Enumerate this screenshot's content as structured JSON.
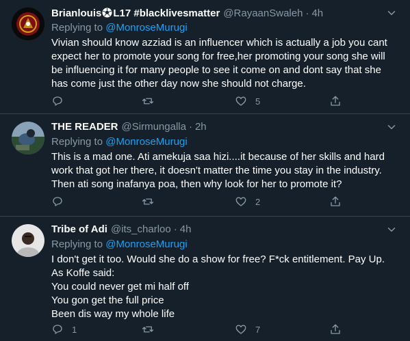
{
  "tweets": [
    {
      "name": "Brianlouis",
      "name_suffix": "L17 #blacklivesmatter",
      "handle": "@RayaanSwaleh",
      "time": "4h",
      "replying_label": "Replying to",
      "replying_to": "@MonroseMurugi",
      "lines": [
        "Vivian should know azziad is an influencer which is actually a job you cant",
        "expect her to promote your song for free,her promoting your song she will",
        "be influencing it for many people to see it come on and dont say that she",
        "has come just the other day now she should not charge."
      ],
      "replies": "",
      "retweets": "",
      "likes": "5",
      "avatar_colors": [
        "#0a0a0a",
        "#7a0f14",
        "#d4a017"
      ]
    },
    {
      "name": "THE READER",
      "handle": "@Sirmungalla",
      "time": "2h",
      "replying_label": "Replying to",
      "replying_to": "@MonroseMurugi",
      "lines": [
        "This is a mad one. Ati amekuja saa hizi....it because of her skills and hard",
        "work that got her there, it doesn't matter the time you stay in the industry.",
        "Then ati song inafanya poa, then why look for her to promote it?"
      ],
      "replies": "",
      "retweets": "",
      "likes": "2",
      "avatar_colors": [
        "#3c5a7a",
        "#8aa2b8",
        "#2d4a33"
      ]
    },
    {
      "name": "Tribe of Adi",
      "handle": "@its_charloo",
      "time": "4h",
      "replying_label": "Replying to",
      "replying_to": "@MonroseMurugi",
      "lines": [
        "I don't get it too. Would she do a show for free? F*ck entitlement. Pay Up.",
        "As Koffe said:",
        "You could never get mi half off",
        "You gon get the full price",
        "Been dis way my whole life"
      ],
      "replies": "1",
      "retweets": "",
      "likes": "7",
      "avatar_colors": [
        "#e6e6e6",
        "#3a2a22",
        "#b9b9b9"
      ]
    }
  ],
  "icons": {
    "reply": "reply-icon",
    "retweet": "retweet-icon",
    "like": "heart-icon",
    "share": "share-icon",
    "more": "chevron-down-icon",
    "soccer": "soccer-ball-icon"
  }
}
